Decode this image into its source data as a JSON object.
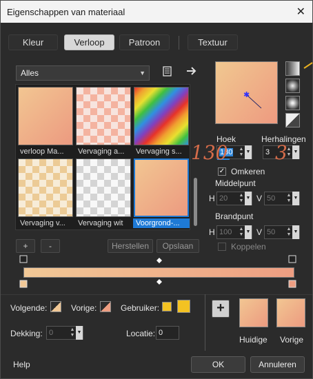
{
  "window": {
    "title": "Eigenschappen van materiaal",
    "close_label": "✕"
  },
  "tabs": [
    {
      "label": "Kleur",
      "active": false
    },
    {
      "label": "Verloop",
      "active": true
    },
    {
      "label": "Patroon",
      "active": false
    },
    {
      "label": "Textuur",
      "active": false
    }
  ],
  "category": {
    "selected": "Alles"
  },
  "thumbnails": [
    {
      "label": "verloop  Ma..."
    },
    {
      "label": "Vervaging a..."
    },
    {
      "label": "Vervaging s..."
    },
    {
      "label": "Vervaging v..."
    },
    {
      "label": "Vervaging wit"
    },
    {
      "label": "Voorgrond-...",
      "selected": true
    }
  ],
  "list_buttons": {
    "add": "+",
    "remove": "-",
    "reset": "Herstellen",
    "save": "Opslaan"
  },
  "angle": {
    "label": "Hoek",
    "value": "130",
    "fill": 0.36
  },
  "repeats": {
    "label": "Herhalingen",
    "value": "3"
  },
  "invert": {
    "label": "Omkeren",
    "checked": true
  },
  "center": {
    "label": "Middelpunt",
    "h_label": "H",
    "h_value": "20",
    "v_label": "V",
    "v_value": "50"
  },
  "focal": {
    "label": "Brandpunt",
    "h_label": "H",
    "h_value": "100",
    "v_label": "V",
    "v_value": "50"
  },
  "link": {
    "label": "Koppelen",
    "checked": false
  },
  "annotations": {
    "angle": "130",
    "repeats": "3"
  },
  "colors": {
    "next_label": "Volgende:",
    "prev_label": "Vorige:",
    "user_label": "Gebruiker:",
    "opacity_label": "Dekking:",
    "opacity_value": "0",
    "location_label": "Locatie:",
    "location_value": "0",
    "user_color": "#f3c222"
  },
  "preview_labels": {
    "current": "Huidige",
    "previous": "Vorige",
    "add": "+"
  },
  "footer": {
    "help": "Help",
    "ok": "OK",
    "cancel": "Annuleren"
  },
  "gradient": {
    "start": "#f1c896",
    "end": "#ee9e82"
  }
}
